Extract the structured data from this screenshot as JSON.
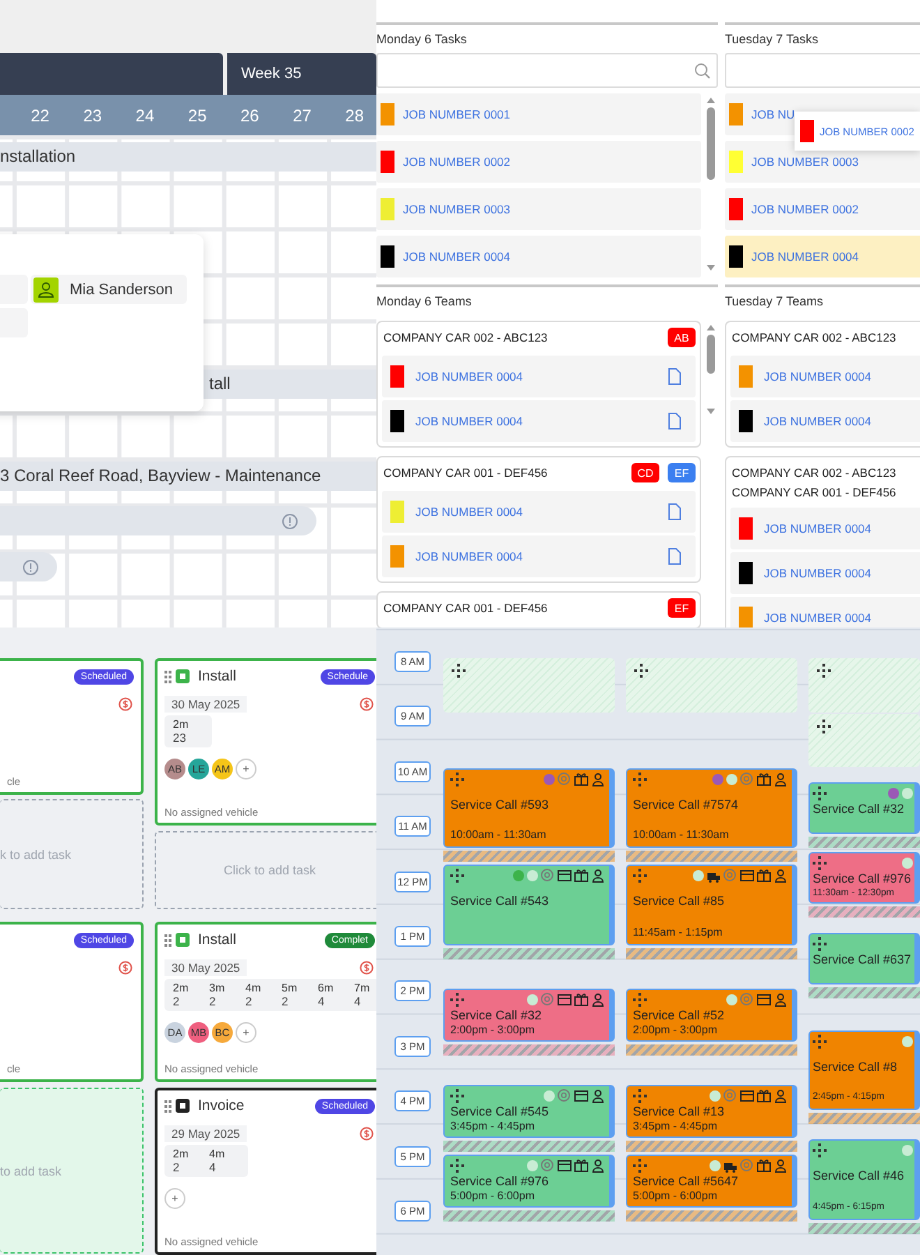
{
  "gantt": {
    "week_label": "Week 35",
    "days": [
      "22",
      "23",
      "24",
      "25",
      "26",
      "27",
      "28"
    ],
    "rows": [
      {
        "kind": "bar",
        "label": "nstallation"
      },
      {
        "kind": "bar",
        "label": "tall"
      },
      {
        "kind": "bar",
        "label": "3 Coral Reef Road, Bayview - Maintenance"
      },
      {
        "kind": "pill"
      },
      {
        "kind": "pill"
      }
    ],
    "popup": {
      "assignee": "Mia Sanderson"
    }
  },
  "planner": {
    "days": [
      {
        "tasks_title": "Monday 6 Tasks",
        "teams_title": "Monday 6 Teams",
        "scrollable": true,
        "search_icon": true,
        "tasks": [
          {
            "label": "JOB NUMBER 0001",
            "color": "#f39200",
            "selected": false
          },
          {
            "label": "JOB NUMBER 0002",
            "color": "#ff0000",
            "selected": false
          },
          {
            "label": "JOB NUMBER 0003",
            "color": "#eeee33",
            "selected": false
          },
          {
            "label": "JOB NUMBER 0004",
            "color": "#000000",
            "selected": false
          }
        ],
        "teams": [
          {
            "vehicles": [
              "COMPANY CAR 002 - ABC123"
            ],
            "badges": [
              {
                "label": "AB",
                "color": "#ff0000"
              }
            ],
            "jobs": [
              {
                "label": "JOB NUMBER 0004",
                "color": "#ff0000",
                "file": true
              },
              {
                "label": "JOB NUMBER 0004",
                "color": "#000000",
                "file": true
              }
            ]
          },
          {
            "vehicles": [
              "COMPANY CAR 001 - DEF456"
            ],
            "badges": [
              {
                "label": "CD",
                "color": "#ff0000"
              },
              {
                "label": "EF",
                "color": "#3b7ff0"
              }
            ],
            "jobs": [
              {
                "label": "JOB NUMBER 0004",
                "color": "#eeee33",
                "file": true
              },
              {
                "label": "JOB NUMBER 0004",
                "color": "#f39200",
                "file": true
              }
            ]
          },
          {
            "vehicles": [
              "COMPANY CAR 001 - DEF456"
            ],
            "badges": [
              {
                "label": "EF",
                "color": "#ff0000"
              }
            ]
          }
        ]
      },
      {
        "tasks_title": "Tuesday 7 Tasks",
        "teams_title": "Tuesday 7 Teams",
        "scrollable": false,
        "search_icon": false,
        "tasks": [
          {
            "label": "JOB NU",
            "color": "#f39200",
            "selected": false
          },
          {
            "label": "JOB NUMBER 0003",
            "color": "#ffff33",
            "selected": false
          },
          {
            "label": "JOB NUMBER 0002",
            "color": "#ff0000",
            "selected": false
          },
          {
            "label": "JOB NUMBER 0004",
            "color": "#000000",
            "selected": true
          }
        ],
        "drag_ghost": {
          "label": "JOB NUMBER 0002",
          "color": "#ff0000"
        },
        "teams": [
          {
            "vehicles": [
              "COMPANY CAR 002 - ABC123"
            ],
            "jobs": [
              {
                "label": "JOB NUMBER 0004",
                "color": "#f39200",
                "file": false
              },
              {
                "label": "JOB NUMBER 0004",
                "color": "#000000",
                "file": false
              }
            ]
          },
          {
            "vehicles": [
              "COMPANY CAR 002 - ABC123",
              "COMPANY CAR 001 - DEF456"
            ],
            "jobs": [
              {
                "label": "JOB NUMBER 0004",
                "color": "#ff0000",
                "file": false
              },
              {
                "label": "JOB NUMBER 0004",
                "color": "#000000",
                "file": false
              },
              {
                "label": "JOB NUMBER 0004",
                "color": "#f39200",
                "file": false
              }
            ]
          }
        ]
      }
    ]
  },
  "board": {
    "rows": [
      {
        "columns": [
          [
            {
              "kind": "task",
              "color": "#3cb34a",
              "status": {
                "label": "Scheduled",
                "color": "#4f46e5"
              },
              "vehicle": "cle"
            },
            {
              "kind": "add",
              "label": "k to add task",
              "highlighted": false
            }
          ],
          [
            {
              "kind": "task",
              "title": "Install",
              "color": "#3cb34a",
              "status": {
                "label": "Schedule",
                "color": "#4f46e5"
              },
              "date": "30 May 2025",
              "counts": [
                {
                  "head": "2m",
                  "value": "23"
                }
              ],
              "people": [
                {
                  "initials": "AB",
                  "color": "#b58c8c"
                },
                {
                  "initials": "LE",
                  "color": "#26a69a"
                },
                {
                  "initials": "AM",
                  "color": "#f5c518"
                }
              ],
              "add_button": "+",
              "vehicle": "No assigned vehicle"
            },
            {
              "kind": "add",
              "label": "Click to add task",
              "highlighted": false
            }
          ]
        ]
      },
      {
        "columns": [
          [
            {
              "kind": "task",
              "color": "#3cb34a",
              "status": {
                "label": "Scheduled",
                "color": "#4f46e5"
              },
              "vehicle": "cle"
            }
          ],
          [
            {
              "kind": "task",
              "title": "Install",
              "color": "#3cb34a",
              "status": {
                "label": "Complet",
                "color": "#1f8a3a"
              },
              "date": "30 May 2025",
              "counts": [
                {
                  "head": "2m",
                  "value": "2"
                },
                {
                  "head": "3m",
                  "value": "2"
                },
                {
                  "head": "4m",
                  "value": "2"
                },
                {
                  "head": "5m",
                  "value": "2"
                },
                {
                  "head": "6m",
                  "value": "4"
                },
                {
                  "head": "7m",
                  "value": "4"
                }
              ],
              "people": [
                {
                  "initials": "DA",
                  "color": "#c9d3df"
                },
                {
                  "initials": "MB",
                  "color": "#ef5f7f"
                },
                {
                  "initials": "BC",
                  "color": "#f6a93b"
                }
              ],
              "add_button": "+",
              "vehicle": "No assigned vehicle"
            }
          ]
        ]
      },
      {
        "columns": [
          [
            {
              "kind": "add",
              "label": "to add task",
              "highlighted": true
            }
          ],
          [
            {
              "kind": "task",
              "title": "Invoice",
              "color": "#222222",
              "status": {
                "label": "Scheduled",
                "color": "#4f46e5"
              },
              "date": "29 May 2025",
              "counts": [
                {
                  "head": "2m",
                  "value": "2"
                },
                {
                  "head": "4m",
                  "value": "4"
                }
              ],
              "add_button": "+",
              "vehicle": "No assigned vehicle"
            }
          ]
        ]
      }
    ]
  },
  "calendar": {
    "hours": [
      "8 AM",
      "9 AM",
      "10 AM",
      "11 AM",
      "12 PM",
      "1 PM",
      "2 PM",
      "3 PM",
      "4 PM",
      "5 PM",
      "6 PM"
    ],
    "columns": [
      {
        "items": [
          {
            "kind": "open"
          },
          {
            "kind": "event",
            "title": "Service Call #593",
            "time": "10:00am - 11:30am",
            "color": "#f08400",
            "icons": [
              {
                "kind": "dot",
                "color": "#9b59b6"
              },
              {
                "kind": "coin"
              },
              {
                "kind": "gift"
              },
              {
                "kind": "person"
              }
            ]
          },
          {
            "kind": "event",
            "title": "Service Call #543",
            "color": "#6ccf94",
            "icons": [
              {
                "kind": "dot",
                "color": "#3cb34a"
              },
              {
                "kind": "dot",
                "color": "#c8ecd4"
              },
              {
                "kind": "coin"
              },
              {
                "kind": "card"
              },
              {
                "kind": "gift"
              },
              {
                "kind": "person"
              }
            ]
          },
          {
            "kind": "event",
            "title": "Service Call #32",
            "time": "2:00pm - 3:00pm",
            "color": "#ee6e86",
            "icons": [
              {
                "kind": "dot",
                "color": "#c8ecd4"
              },
              {
                "kind": "coin"
              },
              {
                "kind": "card"
              },
              {
                "kind": "gift"
              },
              {
                "kind": "person"
              }
            ]
          },
          {
            "kind": "event",
            "title": "Service Call #545",
            "time": "3:45pm - 4:45pm",
            "color": "#6ccf94",
            "icons": [
              {
                "kind": "dot",
                "color": "#c8ecd4"
              },
              {
                "kind": "coin"
              },
              {
                "kind": "card"
              },
              {
                "kind": "person"
              }
            ]
          },
          {
            "kind": "event",
            "title": "Service Call #976",
            "time": "5:00pm - 6:00pm",
            "color": "#6ccf94",
            "icons": [
              {
                "kind": "dot",
                "color": "#c8ecd4"
              },
              {
                "kind": "coin"
              },
              {
                "kind": "card"
              },
              {
                "kind": "gift"
              },
              {
                "kind": "person"
              }
            ]
          }
        ]
      },
      {
        "items": [
          {
            "kind": "open"
          },
          {
            "kind": "event",
            "title": "Service Call #7574",
            "time": "10:00am - 11:30am",
            "color": "#f08400",
            "icons": [
              {
                "kind": "dot",
                "color": "#9b59b6"
              },
              {
                "kind": "dot",
                "color": "#c8ecd4"
              },
              {
                "kind": "coin"
              },
              {
                "kind": "gift"
              },
              {
                "kind": "person"
              }
            ]
          },
          {
            "kind": "event",
            "title": "Service Call #85",
            "time": "11:45am - 1:15pm",
            "color": "#f08400",
            "icons": [
              {
                "kind": "dot",
                "color": "#c8ecd4"
              },
              {
                "kind": "truck"
              },
              {
                "kind": "coin"
              },
              {
                "kind": "card"
              },
              {
                "kind": "gift"
              },
              {
                "kind": "person"
              }
            ]
          },
          {
            "kind": "event",
            "title": "Service Call #52",
            "time": "2:00pm - 3:00pm",
            "color": "#f08400",
            "icons": [
              {
                "kind": "dot",
                "color": "#c8ecd4"
              },
              {
                "kind": "coin"
              },
              {
                "kind": "card"
              },
              {
                "kind": "person"
              }
            ]
          },
          {
            "kind": "event",
            "title": "Service Call #13",
            "time": "3:45pm - 4:45pm",
            "color": "#f08400",
            "icons": [
              {
                "kind": "dot",
                "color": "#c8ecd4"
              },
              {
                "kind": "coin"
              },
              {
                "kind": "card"
              },
              {
                "kind": "gift"
              },
              {
                "kind": "person"
              }
            ]
          },
          {
            "kind": "event",
            "title": "Service Call #5647",
            "time": "5:00pm - 6:00pm",
            "color": "#f08400",
            "icons": [
              {
                "kind": "dot",
                "color": "#c8ecd4"
              },
              {
                "kind": "truck"
              },
              {
                "kind": "coin"
              },
              {
                "kind": "gift"
              },
              {
                "kind": "person"
              }
            ]
          }
        ]
      },
      {
        "items": [
          {
            "kind": "open"
          },
          {
            "kind": "open"
          },
          {
            "kind": "event",
            "title": "Service Call #32",
            "color": "#6ccf94",
            "icons": [
              {
                "kind": "dot",
                "color": "#9b59b6"
              },
              {
                "kind": "dot",
                "color": "#c8ecd4"
              }
            ]
          },
          {
            "kind": "event",
            "title": "Service Call #976",
            "time": "11:30am - 12:30pm",
            "color": "#ee6e86",
            "icons": [
              {
                "kind": "dot",
                "color": "#c8ecd4"
              }
            ]
          },
          {
            "kind": "event",
            "title": "Service Call #637",
            "color": "#6ccf94"
          },
          {
            "kind": "event",
            "title": "Service Call #8",
            "time": "2:45pm - 4:15pm",
            "color": "#f08400",
            "icons": [
              {
                "kind": "dot",
                "color": "#c8ecd4"
              }
            ]
          },
          {
            "kind": "event",
            "title": "Service Call #46",
            "time": "4:45pm - 6:15pm",
            "color": "#6ccf94",
            "icons": [
              {
                "kind": "dot",
                "color": "#c8ecd4"
              }
            ]
          }
        ]
      }
    ]
  }
}
